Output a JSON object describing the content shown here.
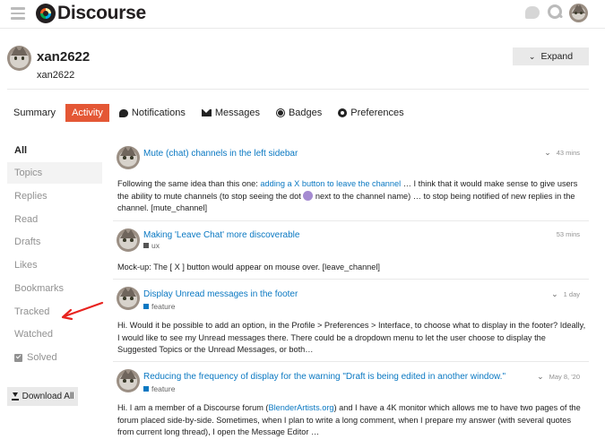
{
  "header": {
    "logo_text": "Discourse",
    "icons": [
      "hamburger-menu-icon",
      "chat-icon",
      "search-icon",
      "user-avatar"
    ]
  },
  "profile": {
    "name": "xan2622",
    "username": "xan2622",
    "expand_label": "Expand"
  },
  "tabs": [
    {
      "label": "Summary",
      "icon": "",
      "active": false
    },
    {
      "label": "Activity",
      "icon": "",
      "active": true
    },
    {
      "label": "Notifications",
      "icon": "comment-bubble-icon",
      "active": false
    },
    {
      "label": "Messages",
      "icon": "envelope-icon",
      "active": false
    },
    {
      "label": "Badges",
      "icon": "badge-icon",
      "active": false
    },
    {
      "label": "Preferences",
      "icon": "gear-icon",
      "active": false
    }
  ],
  "sidebar": {
    "items": [
      {
        "label": "All",
        "active": true
      },
      {
        "label": "Topics",
        "active": false
      },
      {
        "label": "Replies",
        "active": false
      },
      {
        "label": "Read",
        "active": false
      },
      {
        "label": "Drafts",
        "active": false
      },
      {
        "label": "Likes",
        "active": false
      },
      {
        "label": "Bookmarks",
        "active": false
      },
      {
        "label": "Tracked",
        "active": false
      },
      {
        "label": "Watched",
        "active": false
      },
      {
        "label": "Solved",
        "active": false
      }
    ],
    "download_label": "Download All"
  },
  "posts": [
    {
      "title": "Mute (chat) channels in the left sidebar",
      "category": "",
      "time": "43 mins",
      "body_before_link": "Following the same idea than this one: ",
      "link_text": "adding a X button to leave the channel",
      "body_after_link": " … I think that it would make sense to give users the ability to mute channels (to stop seeing the dot ",
      "body_after_dot": " next to the channel name) … to stop being notified of new replies in the channel. [mute_channel]"
    },
    {
      "title": "Making 'Leave Chat' more discoverable",
      "category": "ux",
      "category_color": "#555555",
      "time": "53 mins",
      "body": "Mock-up: The [ X ] button would appear on mouse over. [leave_channel]"
    },
    {
      "title": "Display Unread messages in the footer",
      "category": "feature",
      "category_color": "#0a78c2",
      "time": "1 day",
      "body": "Hi. Would it be possible to add an option, in the Profile > Preferences > Interface, to choose what to display in the footer? Ideally, I would like to see my Unread messages there. There could be a dropdown menu to let the user choose to display the Suggested Topics or the Unread Messages, or both…"
    },
    {
      "title": "Reducing the frequency of display for the warning \"Draft is being edited in another window.\"",
      "category": "feature",
      "category_color": "#0a78c2",
      "time": "May 8, '20",
      "body_before_link": "Hi. I am a member of a Discourse forum (",
      "link_text": "BlenderArtists.org",
      "body_after_link": ") and I have a 4K monitor which allows me to have two pages of the forum placed side-by-side. Sometimes, when I plan to write a long comment, when I prepare my answer (with several quotes from current long thread), I open the Message Editor …"
    }
  ],
  "colors": {
    "accent": "#e45735",
    "link": "#0a78c2",
    "muted": "#919191"
  }
}
